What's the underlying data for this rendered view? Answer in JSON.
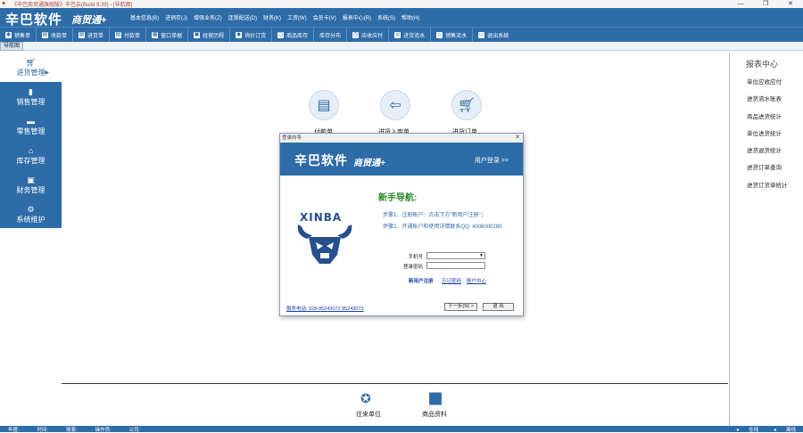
{
  "window": {
    "title": "《辛巴商贸通旗舰版》辛巴云(Build 9.39) - [导航图]",
    "controls": [
      "—",
      "❐",
      "✕"
    ]
  },
  "header": {
    "logo": "辛巴软件",
    "logo_sub": "商贸通+",
    "menu": [
      "基本信息(B)",
      "进销存(J)",
      "增强业务(Z)",
      "连锁配送(D)",
      "财务(K)",
      "工资(W)",
      "会员卡(V)",
      "报表中心(R)",
      "系统(S)",
      "帮助(H)"
    ]
  },
  "toolbar": {
    "items": [
      "销售单",
      "收款单",
      "进货单",
      "付款单",
      "窗口单据",
      "经营历程",
      "询价订货",
      "商品库存",
      "库存分布",
      "应收应付",
      "进货流水",
      "销售流水",
      "退出系统"
    ]
  },
  "tabs": {
    "active": "导航图"
  },
  "leftnav": {
    "items": [
      {
        "label": "进货管理",
        "icon": "cart-icon"
      },
      {
        "label": "销售管理",
        "icon": "bar-chart-icon"
      },
      {
        "label": "零售管理",
        "icon": "pos-icon"
      },
      {
        "label": "库存管理",
        "icon": "warehouse-icon"
      },
      {
        "label": "财务管理",
        "icon": "cash-box-icon"
      },
      {
        "label": "系统维护",
        "icon": "gear-icon"
      }
    ]
  },
  "main": {
    "flow": [
      {
        "label": "付款单",
        "icon": "payment-icon"
      },
      {
        "label": "进货入库单",
        "icon": "inbound-icon"
      },
      {
        "label": "进货订单",
        "icon": "cart-icon"
      }
    ],
    "bottom": [
      {
        "label": "往来单位",
        "icon": "partner-icon"
      },
      {
        "label": "商品资料",
        "icon": "goods-icon"
      }
    ]
  },
  "rightpanel": {
    "title": "报表中心",
    "items": [
      "单位应收应付",
      "进货流水账表",
      "商品进货统计",
      "单位进货统计",
      "进货退货统计",
      "进货订单查询",
      "进货订货单统计"
    ]
  },
  "dialog": {
    "title": "登录向导",
    "banner_logo": "辛巴软件",
    "banner_logo_sub": "商贸通+",
    "login_link": "用户登录 >>",
    "brand": "XINBA",
    "guide_title": "新手导航:",
    "steps": [
      "步骤1、注册账户：点击下方\"新用户注册\"；",
      "步骤2、开通账户和使用详情联系QQ: 4006000280"
    ],
    "phone_label": "手机号",
    "password_label": "登录密码",
    "register_link": "新用户注册",
    "forgot_link": "忘记密码",
    "account_link": "账户中心",
    "service_phone": "服务电话: 028-85243072  85243073",
    "next_button": "下一步(N) >",
    "exit_button": "退 出"
  },
  "statusbar": {
    "fields": [
      "年度:",
      "时间:",
      "账套:",
      "操作员:",
      "公司:"
    ],
    "online": "在线",
    "offline": "离线"
  },
  "colors": {
    "accent": "#2e6ca8",
    "guide_title": "#2a8a2a"
  }
}
